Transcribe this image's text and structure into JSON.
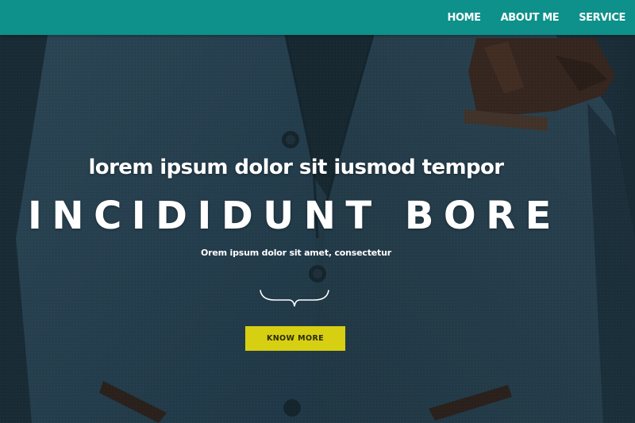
{
  "nav": {
    "items": [
      {
        "label": "HOME"
      },
      {
        "label": "ABOUT ME"
      },
      {
        "label": "SERVICE"
      }
    ]
  },
  "hero": {
    "tagline": "lorem ipsum dolor sit iusmod tempor",
    "headline": "INCIDIDUNT BORE",
    "subline": "Orem ipsum dolor sit amet, consectetur",
    "cta_label": "KNOW MORE"
  },
  "colors": {
    "nav_background": "#0d918a",
    "cta_background": "#d7cf12",
    "text": "#ffffff"
  },
  "icons": {
    "divider": "curly-brace-divider-icon"
  }
}
